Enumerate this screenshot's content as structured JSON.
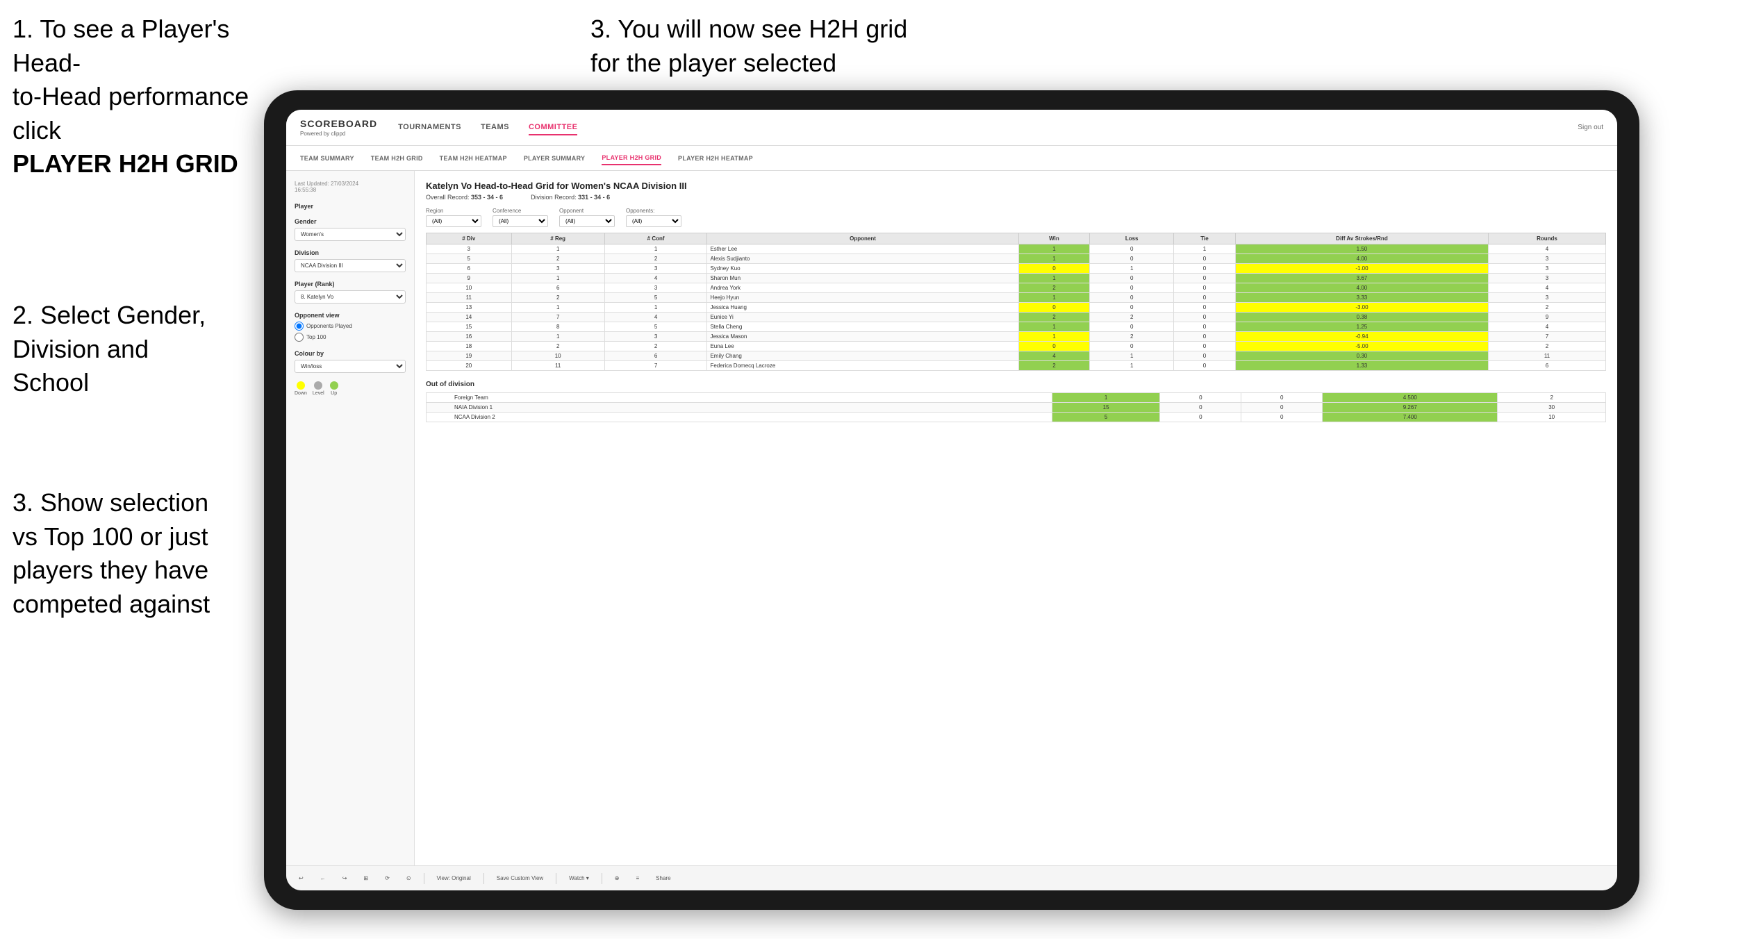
{
  "instructions": {
    "top_left_line1": "1. To see a Player's Head-",
    "top_left_line2": "to-Head performance click",
    "top_left_bold": "PLAYER H2H GRID",
    "top_right": "3. You will now see H2H grid\nfor the player selected",
    "mid_left_title": "2. Select Gender,\nDivision and\nSchool",
    "bottom_left": "3. Show selection\nvs Top 100 or just\nplayers they have\ncompeted against"
  },
  "nav": {
    "logo": "SCOREBOARD",
    "logo_sub": "Powered by clippd",
    "items": [
      "TOURNAMENTS",
      "TEAMS",
      "COMMITTEE"
    ],
    "active_item": "COMMITTEE",
    "sign_out": "Sign out"
  },
  "sub_nav": {
    "items": [
      "TEAM SUMMARY",
      "TEAM H2H GRID",
      "TEAM H2H HEATMAP",
      "PLAYER SUMMARY",
      "PLAYER H2H GRID",
      "PLAYER H2H HEATMAP"
    ],
    "active": "PLAYER H2H GRID"
  },
  "sidebar": {
    "timestamp": "Last Updated: 27/03/2024\n16:55:38",
    "player_label": "Player",
    "gender_label": "Gender",
    "gender_value": "Women's",
    "division_label": "Division",
    "division_value": "NCAA Division III",
    "player_rank_label": "Player (Rank)",
    "player_rank_value": "8. Katelyn Vo",
    "opponent_view_label": "Opponent view",
    "opponents_played_label": "Opponents Played",
    "top100_label": "Top 100",
    "colour_by_label": "Colour by",
    "colour_by_value": "Win/loss",
    "legend": [
      {
        "color": "#ffff00",
        "label": "Down"
      },
      {
        "color": "#aaaaaa",
        "label": "Level"
      },
      {
        "color": "#92d050",
        "label": "Up"
      }
    ]
  },
  "panel": {
    "title": "Katelyn Vo Head-to-Head Grid for Women's NCAA Division III",
    "overall_record_label": "Overall Record:",
    "overall_record": "353 - 34 - 6",
    "division_record_label": "Division Record:",
    "division_record": "331 - 34 - 6",
    "filters": {
      "region_label": "Region",
      "conference_label": "Conference",
      "opponent_label": "Opponent",
      "opponents_label": "Opponents:",
      "region_value": "(All)",
      "conference_value": "(All)",
      "opponent_value": "(All)"
    },
    "table_headers": [
      "# Div",
      "# Reg",
      "# Conf",
      "Opponent",
      "Win",
      "Loss",
      "Tie",
      "Diff Av Strokes/Rnd",
      "Rounds"
    ],
    "rows": [
      {
        "div": "3",
        "reg": "1",
        "conf": "1",
        "opponent": "Esther Lee",
        "win": "1",
        "loss": "0",
        "tie": "1",
        "diff": "1.50",
        "rounds": "4",
        "win_color": "green"
      },
      {
        "div": "5",
        "reg": "2",
        "conf": "2",
        "opponent": "Alexis Sudjianto",
        "win": "1",
        "loss": "0",
        "tie": "0",
        "diff": "4.00",
        "rounds": "3",
        "win_color": "green"
      },
      {
        "div": "6",
        "reg": "3",
        "conf": "3",
        "opponent": "Sydney Kuo",
        "win": "0",
        "loss": "1",
        "tie": "0",
        "diff": "-1.00",
        "rounds": "3",
        "win_color": "yellow"
      },
      {
        "div": "9",
        "reg": "1",
        "conf": "4",
        "opponent": "Sharon Mun",
        "win": "1",
        "loss": "0",
        "tie": "0",
        "diff": "3.67",
        "rounds": "3",
        "win_color": "green"
      },
      {
        "div": "10",
        "reg": "6",
        "conf": "3",
        "opponent": "Andrea York",
        "win": "2",
        "loss": "0",
        "tie": "0",
        "diff": "4.00",
        "rounds": "4",
        "win_color": "green"
      },
      {
        "div": "11",
        "reg": "2",
        "conf": "5",
        "opponent": "Heejo Hyun",
        "win": "1",
        "loss": "0",
        "tie": "0",
        "diff": "3.33",
        "rounds": "3",
        "win_color": "green"
      },
      {
        "div": "13",
        "reg": "1",
        "conf": "1",
        "opponent": "Jessica Huang",
        "win": "0",
        "loss": "0",
        "tie": "0",
        "diff": "-3.00",
        "rounds": "2",
        "win_color": "yellow"
      },
      {
        "div": "14",
        "reg": "7",
        "conf": "4",
        "opponent": "Eunice Yi",
        "win": "2",
        "loss": "2",
        "tie": "0",
        "diff": "0.38",
        "rounds": "9",
        "win_color": "green"
      },
      {
        "div": "15",
        "reg": "8",
        "conf": "5",
        "opponent": "Stella Cheng",
        "win": "1",
        "loss": "0",
        "tie": "0",
        "diff": "1.25",
        "rounds": "4",
        "win_color": "green"
      },
      {
        "div": "16",
        "reg": "1",
        "conf": "3",
        "opponent": "Jessica Mason",
        "win": "1",
        "loss": "2",
        "tie": "0",
        "diff": "-0.94",
        "rounds": "7",
        "win_color": "yellow"
      },
      {
        "div": "18",
        "reg": "2",
        "conf": "2",
        "opponent": "Euna Lee",
        "win": "0",
        "loss": "0",
        "tie": "0",
        "diff": "-5.00",
        "rounds": "2",
        "win_color": "yellow"
      },
      {
        "div": "19",
        "reg": "10",
        "conf": "6",
        "opponent": "Emily Chang",
        "win": "4",
        "loss": "1",
        "tie": "0",
        "diff": "0.30",
        "rounds": "11",
        "win_color": "green"
      },
      {
        "div": "20",
        "reg": "11",
        "conf": "7",
        "opponent": "Federica Domecq Lacroze",
        "win": "2",
        "loss": "1",
        "tie": "0",
        "diff": "1.33",
        "rounds": "6",
        "win_color": "green"
      }
    ],
    "out_of_division_label": "Out of division",
    "out_of_division_rows": [
      {
        "label": "Foreign Team",
        "win": "1",
        "loss": "0",
        "tie": "0",
        "diff": "4.500",
        "rounds": "2"
      },
      {
        "label": "NAIA Division 1",
        "win": "15",
        "loss": "0",
        "tie": "0",
        "diff": "9.267",
        "rounds": "30"
      },
      {
        "label": "NCAA Division 2",
        "win": "5",
        "loss": "0",
        "tie": "0",
        "diff": "7.400",
        "rounds": "10"
      }
    ]
  },
  "toolbar": {
    "buttons": [
      "↩",
      "←",
      "↪",
      "⊞",
      "⟳",
      "⊙",
      "View: Original",
      "Save Custom View",
      "Watch ▾",
      "⊕",
      "≡",
      "Share"
    ]
  },
  "colors": {
    "active_nav": "#e8326e",
    "green": "#92d050",
    "yellow": "#ffff00",
    "light_green": "#c6efce",
    "orange": "#ffc000",
    "gray": "#aaaaaa"
  }
}
